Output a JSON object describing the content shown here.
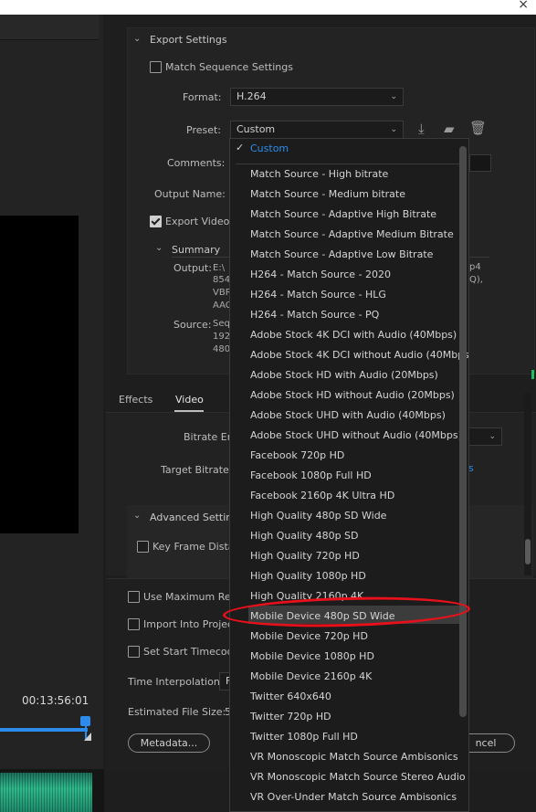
{
  "window": {
    "close_glyph": "×"
  },
  "timeline": {
    "timecode": "00:13:56:01"
  },
  "export_settings": {
    "section_title": "Export Settings",
    "match_sequence_label": "Match Sequence Settings",
    "format_label": "Format:",
    "format_value": "H.264",
    "preset_label": "Preset:",
    "preset_value": "Custom",
    "comments_label": "Comments:",
    "output_name_label": "Output Name:",
    "export_video_label": "Export Video",
    "summary_label": "Summary",
    "output_label": "Output:",
    "output_lines": [
      "E:\\",
      "854",
      "VBR",
      "AAC"
    ],
    "output_suffix_lines": [
      "p4",
      "Q),"
    ],
    "source_label": "Source:",
    "source_lines": [
      "Seq",
      "192",
      "480"
    ]
  },
  "tabs": [
    {
      "label": "Effects"
    },
    {
      "label": "Video"
    }
  ],
  "video_settings": {
    "bitrate_encoding_label": "Bitrate En",
    "target_bitrate_label": "Target Bitrate [",
    "target_bitrate_value_hint": "s",
    "advanced_label": "Advanced Setting",
    "keyframe_label": "Key Frame Dista"
  },
  "bottom": {
    "use_max_render_label": "Use Maximum Ren",
    "import_into_project_label": "Import Into Project",
    "set_start_timecode_label": "Set Start Timecode",
    "time_interpolation_label": "Time Interpolation:",
    "time_interpolation_value": "F",
    "estimated_file_size_label": "Estimated File Size:",
    "estimated_file_size_value": "5",
    "metadata_button": "Metadata...",
    "cancel_button": "ncel"
  },
  "preset_menu": {
    "selected": "Custom",
    "items": [
      "Match Source - High bitrate",
      "Match Source - Medium bitrate",
      "Match Source - Adaptive High Bitrate",
      "Match Source - Adaptive Medium Bitrate",
      "Match Source - Adaptive Low Bitrate",
      "H264 - Match Source - 2020",
      "H264 - Match Source - HLG",
      "H264 - Match Source - PQ",
      "Adobe Stock 4K DCI with Audio (40Mbps)",
      "Adobe Stock 4K DCI without Audio (40Mbps)",
      "Adobe Stock HD with Audio (20Mbps)",
      "Adobe Stock HD without Audio (20Mbps)",
      "Adobe Stock UHD with Audio (40Mbps)",
      "Adobe Stock UHD without Audio (40Mbps)",
      "Facebook 720p HD",
      "Facebook 1080p Full HD",
      "Facebook 2160p 4K Ultra HD",
      "High Quality 480p SD Wide",
      "High Quality 480p SD",
      "High Quality 720p HD",
      "High Quality 1080p HD",
      "High Quality 2160p 4K",
      "Mobile Device 480p SD Wide",
      "Mobile Device 720p HD",
      "Mobile Device 1080p HD",
      "Mobile Device 2160p 4K",
      "Twitter 640x640",
      "Twitter 720p HD",
      "Twitter 1080p Full HD",
      "VR Monoscopic Match Source Ambisonics",
      "VR Monoscopic Match Source Stereo Audio",
      "VR Over-Under Match Source Ambisonics"
    ],
    "highlighted": "Mobile Device 480p SD Wide",
    "annotation_color": "#e8101a"
  },
  "colors": {
    "accent": "#2d8ceb"
  }
}
